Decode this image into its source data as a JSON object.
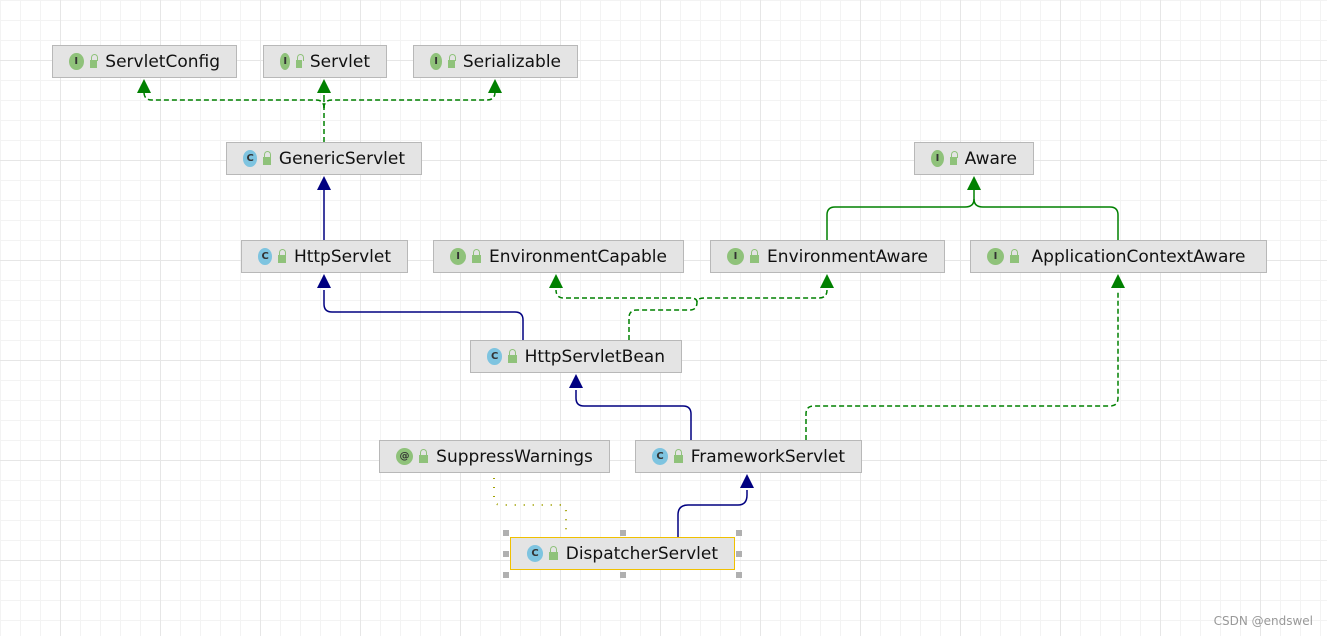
{
  "nodes": [
    {
      "id": "servletconfig",
      "label": "ServletConfig",
      "kind": "interface",
      "kind_glyph": "I"
    },
    {
      "id": "servlet",
      "label": "Servlet",
      "kind": "interface",
      "kind_glyph": "I"
    },
    {
      "id": "serializable",
      "label": "Serializable",
      "kind": "interface",
      "kind_glyph": "I"
    },
    {
      "id": "genericservlet",
      "label": "GenericServlet",
      "kind": "abstract-class",
      "kind_glyph": "C"
    },
    {
      "id": "aware",
      "label": "Aware",
      "kind": "interface",
      "kind_glyph": "I"
    },
    {
      "id": "httpservlet",
      "label": "HttpServlet",
      "kind": "abstract-class",
      "kind_glyph": "C"
    },
    {
      "id": "environmentcapable",
      "label": "EnvironmentCapable",
      "kind": "interface",
      "kind_glyph": "I"
    },
    {
      "id": "environmentaware",
      "label": "EnvironmentAware",
      "kind": "interface",
      "kind_glyph": "I"
    },
    {
      "id": "applicationcontextaware",
      "label": "ApplicationContextAware",
      "kind": "interface",
      "kind_glyph": "I"
    },
    {
      "id": "httpservletbean",
      "label": "HttpServletBean",
      "kind": "abstract-class",
      "kind_glyph": "C"
    },
    {
      "id": "suppresswarnings",
      "label": "SuppressWarnings",
      "kind": "annotation",
      "kind_glyph": "@"
    },
    {
      "id": "frameworkservlet",
      "label": "FrameworkServlet",
      "kind": "abstract-class",
      "kind_glyph": "C"
    },
    {
      "id": "dispatcherservlet",
      "label": "DispatcherServlet",
      "kind": "class",
      "kind_glyph": "C",
      "selected": true
    }
  ],
  "edges": [
    {
      "from": "genericservlet",
      "to": "servletconfig",
      "type": "implements"
    },
    {
      "from": "genericservlet",
      "to": "servlet",
      "type": "implements"
    },
    {
      "from": "genericservlet",
      "to": "serializable",
      "type": "implements"
    },
    {
      "from": "httpservlet",
      "to": "genericservlet",
      "type": "extends"
    },
    {
      "from": "environmentaware",
      "to": "aware",
      "type": "extends-interface"
    },
    {
      "from": "applicationcontextaware",
      "to": "aware",
      "type": "extends-interface"
    },
    {
      "from": "httpservletbean",
      "to": "httpservlet",
      "type": "extends"
    },
    {
      "from": "httpservletbean",
      "to": "environmentcapable",
      "type": "implements"
    },
    {
      "from": "httpservletbean",
      "to": "environmentaware",
      "type": "implements"
    },
    {
      "from": "frameworkservlet",
      "to": "httpservletbean",
      "type": "extends"
    },
    {
      "from": "frameworkservlet",
      "to": "applicationcontextaware",
      "type": "implements"
    },
    {
      "from": "dispatcherservlet",
      "to": "frameworkservlet",
      "type": "extends"
    },
    {
      "from": "dispatcherservlet",
      "to": "suppresswarnings",
      "type": "annotated"
    }
  ],
  "colors": {
    "extends": "#000080",
    "implements": "#008000",
    "annotated": "#a0a000",
    "selection": "#f0c000"
  },
  "watermark": "CSDN @endswel"
}
